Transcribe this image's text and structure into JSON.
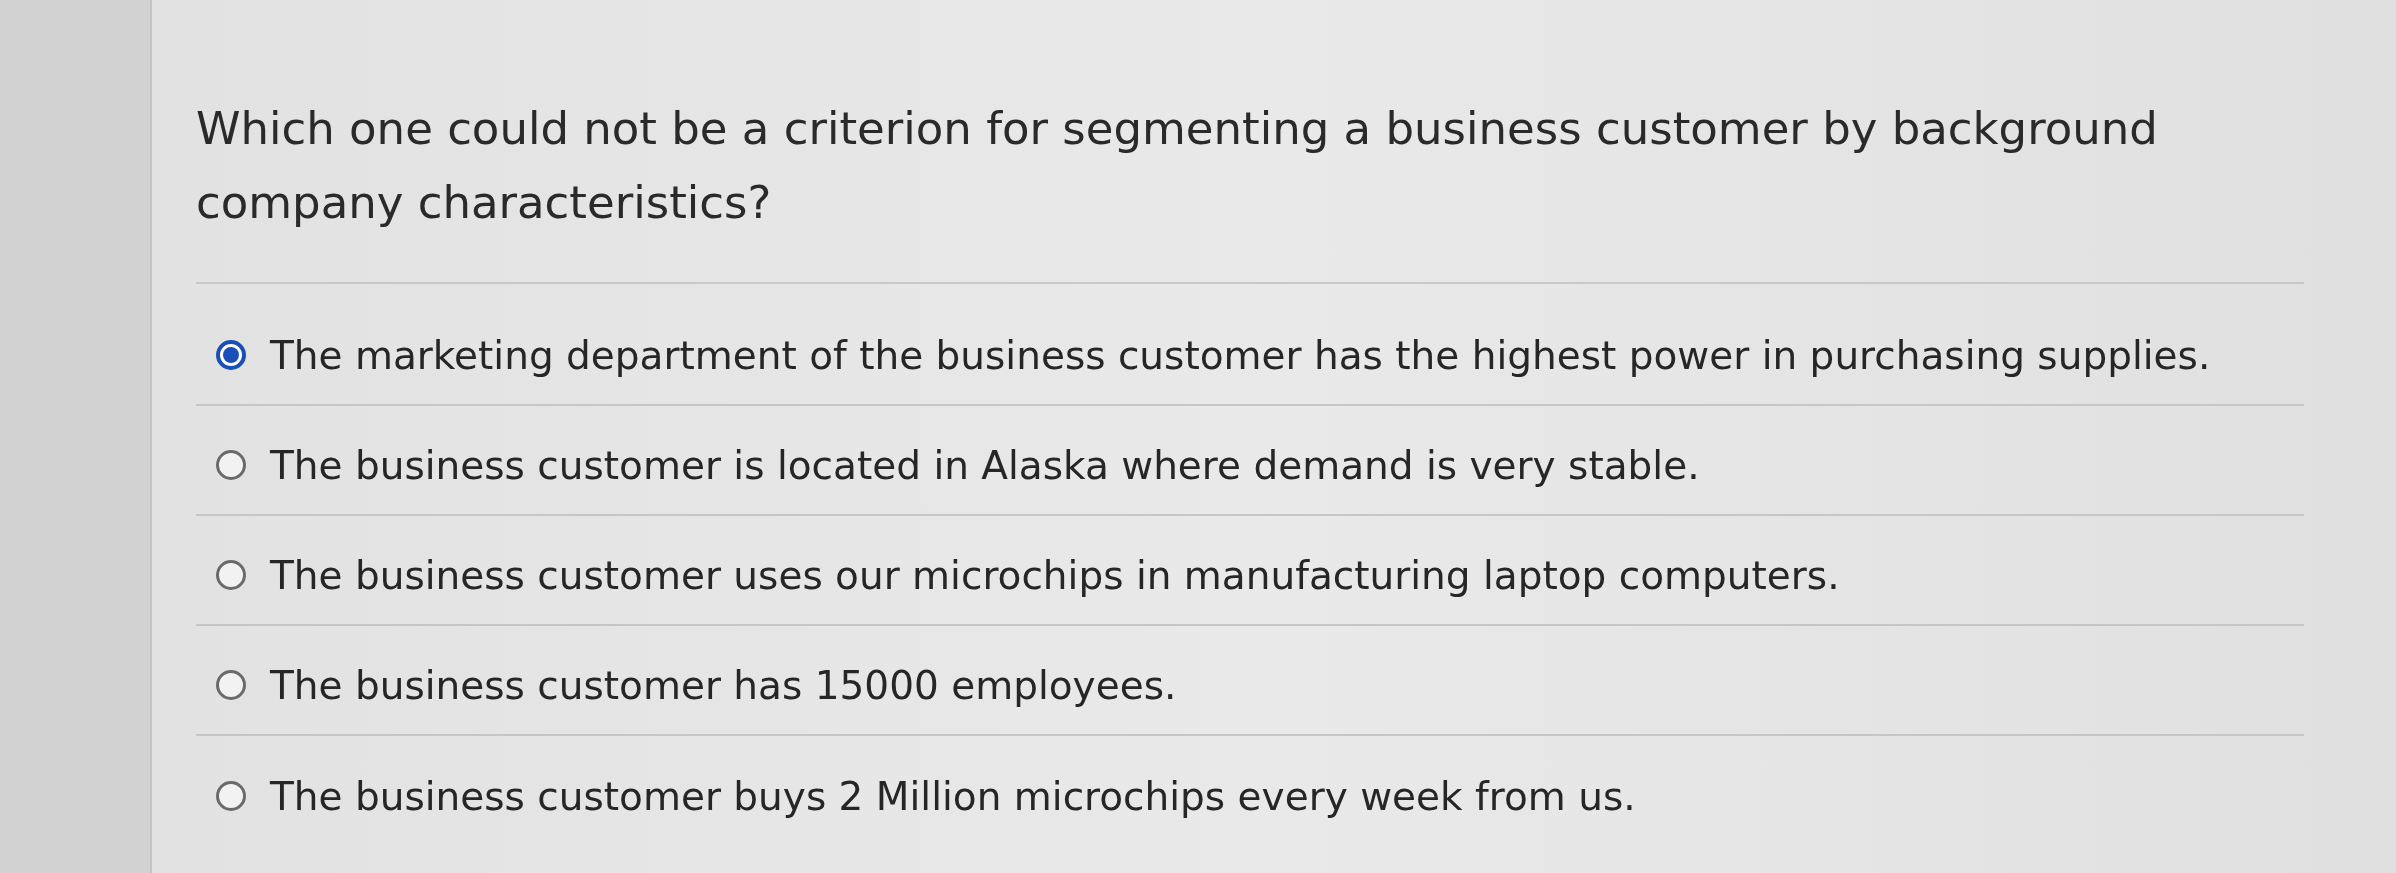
{
  "question": "Which one could not be a criterion for segmenting a business customer by background company characteristics?",
  "options": [
    {
      "label": "The marketing department of the business customer has the highest power in purchasing supplies.",
      "selected": true
    },
    {
      "label": "The business customer is located in Alaska where demand is very stable.",
      "selected": false
    },
    {
      "label": "The business customer uses our microchips in manufacturing laptop computers.",
      "selected": false
    },
    {
      "label": "The business customer has 15000 employees.",
      "selected": false
    },
    {
      "label": "The business customer buys 2 Million microchips every week from us.",
      "selected": false
    }
  ]
}
